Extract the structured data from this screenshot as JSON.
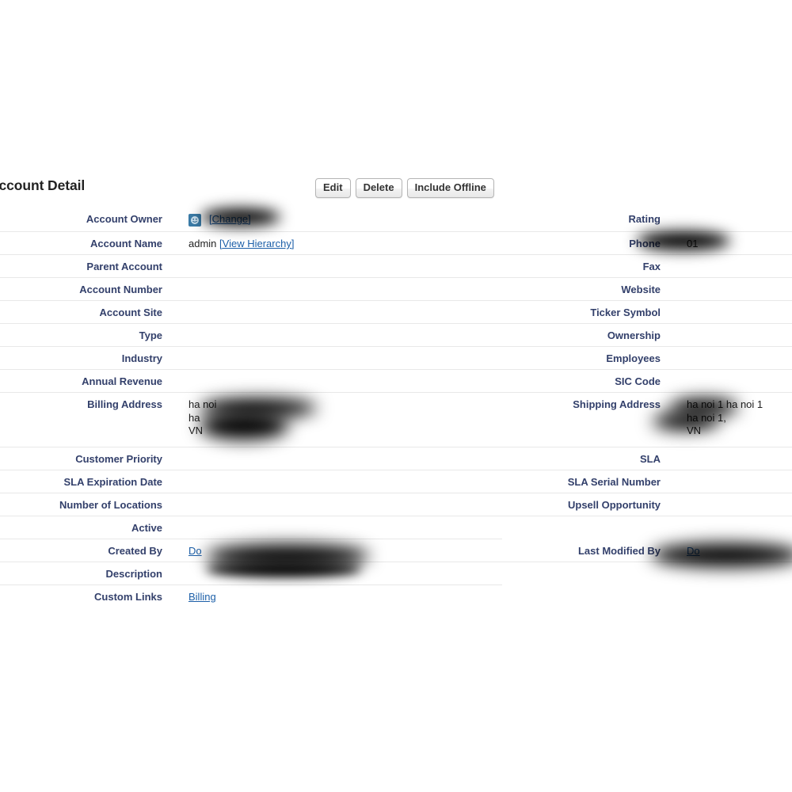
{
  "page": {
    "section_title": "Account Detail",
    "background_color": "#ffffff",
    "label_color": "#33406b",
    "link_color": "#1c5fa8"
  },
  "buttons": [
    {
      "label": "Edit",
      "name": "edit-button"
    },
    {
      "label": "Delete",
      "name": "delete-button"
    },
    {
      "label": "Include Offline",
      "name": "include-offline-button"
    }
  ],
  "fields": {
    "account_owner": {
      "label": "Account Owner",
      "owner_name": "",
      "change_link": "[Change]",
      "avatar_icon": "user-avatar-icon"
    },
    "account_name": {
      "label": "Account Name",
      "value": "admin",
      "hierarchy_link": "[View Hierarchy]"
    },
    "parent_account": {
      "label": "Parent Account",
      "value": ""
    },
    "account_number": {
      "label": "Account Number",
      "value": ""
    },
    "account_site": {
      "label": "Account Site",
      "value": ""
    },
    "type": {
      "label": "Type",
      "value": ""
    },
    "industry": {
      "label": "Industry",
      "value": ""
    },
    "annual_revenue": {
      "label": "Annual Revenue",
      "value": ""
    },
    "billing_address": {
      "label": "Billing Address",
      "line1": "ha noi",
      "line2": "ha",
      "line3": "VN"
    },
    "customer_priority": {
      "label": "Customer Priority",
      "value": ""
    },
    "sla_expiration_date": {
      "label": "SLA Expiration Date",
      "value": ""
    },
    "number_of_locations": {
      "label": "Number of Locations",
      "value": ""
    },
    "active": {
      "label": "Active",
      "value": ""
    },
    "created_by": {
      "label": "Created By",
      "value": "Do"
    },
    "description": {
      "label": "Description",
      "value": ""
    },
    "custom_links": {
      "label": "Custom Links",
      "billing_link": "Billing"
    },
    "rating": {
      "label": "Rating",
      "value": ""
    },
    "phone": {
      "label": "Phone",
      "value": "01"
    },
    "fax": {
      "label": "Fax",
      "value": ""
    },
    "website": {
      "label": "Website",
      "value": ""
    },
    "ticker_symbol": {
      "label": "Ticker Symbol",
      "value": ""
    },
    "ownership": {
      "label": "Ownership",
      "value": ""
    },
    "employees": {
      "label": "Employees",
      "value": ""
    },
    "sic_code": {
      "label": "SIC Code",
      "value": ""
    },
    "shipping_address": {
      "label": "Shipping Address",
      "line1": "ha noi 1 ha noi 1",
      "line2": "ha noi 1,",
      "line3": "VN"
    },
    "sla": {
      "label": "SLA",
      "value": ""
    },
    "sla_serial_number": {
      "label": "SLA Serial Number",
      "value": ""
    },
    "upsell_opportunity": {
      "label": "Upsell Opportunity",
      "value": ""
    },
    "last_modified_by": {
      "label": "Last Modified By",
      "value": "Do"
    }
  }
}
